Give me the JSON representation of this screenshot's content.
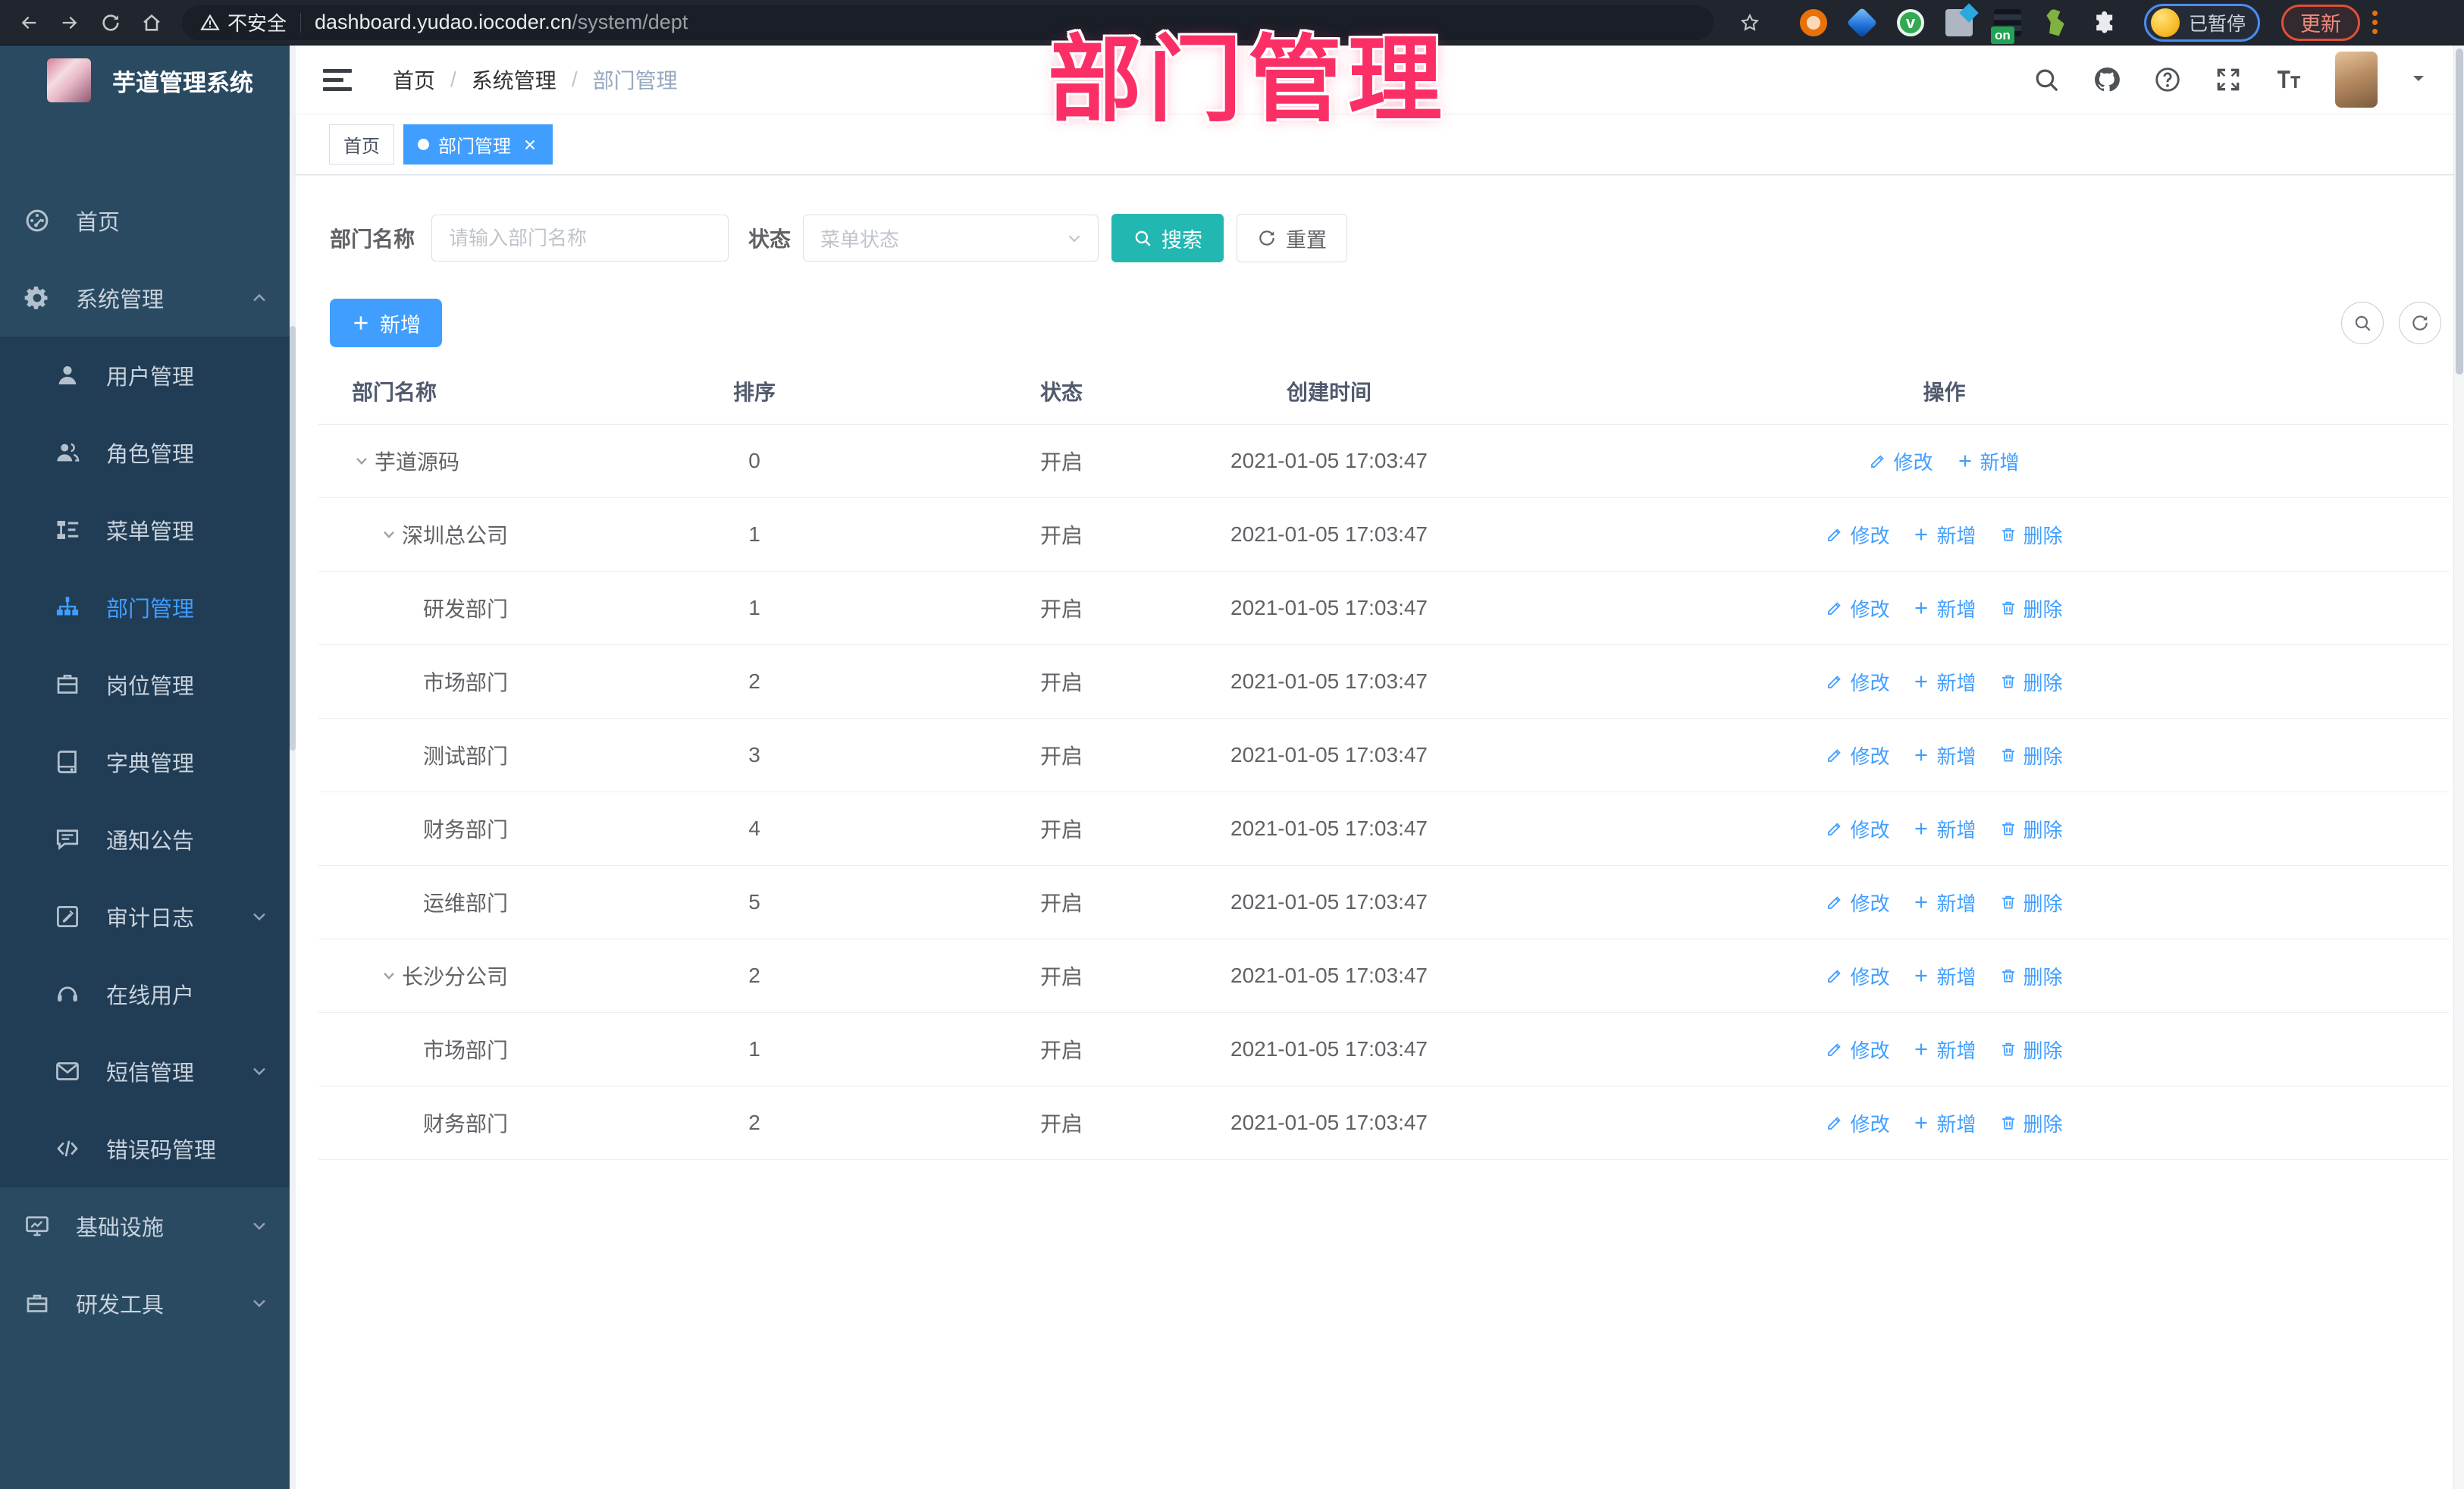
{
  "watermark": "部门管理",
  "colors": {
    "primary_blue": "#409eff",
    "search_teal": "#23b7b2",
    "watermark_pink": "#fb2f66",
    "sidebar_bg": "#2a4a62",
    "submenu_bg": "#213c55",
    "active_tab_bg": "#409eff"
  },
  "browser": {
    "security_label": "不安全",
    "url_host": "dashboard.yudao.iocoder.cn",
    "url_path": "/system/dept",
    "extension_badge": "on",
    "profile_status": "已暂停",
    "update_label": "更新"
  },
  "sidebar": {
    "title": "芋道管理系统",
    "items": [
      {
        "key": "home",
        "icon": "dashboard",
        "label": "首页",
        "sub": false
      },
      {
        "key": "system",
        "icon": "gear",
        "label": "系统管理",
        "sub": false,
        "chevron": "up"
      },
      {
        "key": "user",
        "icon": "user",
        "label": "用户管理",
        "sub": true
      },
      {
        "key": "role",
        "icon": "users",
        "label": "角色管理",
        "sub": true
      },
      {
        "key": "menu",
        "icon": "tree",
        "label": "菜单管理",
        "sub": true
      },
      {
        "key": "dept",
        "icon": "org",
        "label": "部门管理",
        "sub": true,
        "active": true
      },
      {
        "key": "post",
        "icon": "post",
        "label": "岗位管理",
        "sub": true
      },
      {
        "key": "dict",
        "icon": "book",
        "label": "字典管理",
        "sub": true
      },
      {
        "key": "notice",
        "icon": "notice",
        "label": "通知公告",
        "sub": true
      },
      {
        "key": "audit",
        "icon": "log",
        "label": "审计日志",
        "sub": true,
        "chevron": "down"
      },
      {
        "key": "online",
        "icon": "online",
        "label": "在线用户",
        "sub": true
      },
      {
        "key": "sms",
        "icon": "sms",
        "label": "短信管理",
        "sub": true,
        "chevron": "down"
      },
      {
        "key": "errcode",
        "icon": "code",
        "label": "错误码管理",
        "sub": true
      },
      {
        "key": "infra",
        "icon": "infra",
        "label": "基础设施",
        "sub": false,
        "chevron": "down"
      },
      {
        "key": "tools",
        "icon": "tools",
        "label": "研发工具",
        "sub": false,
        "chevron": "down"
      }
    ]
  },
  "header": {
    "breadcrumb": [
      "首页",
      "系统管理",
      "部门管理"
    ]
  },
  "tabs": [
    {
      "label": "首页",
      "active": false
    },
    {
      "label": "部门管理",
      "active": true,
      "closable": true
    }
  ],
  "filters": {
    "dept_label": "部门名称",
    "dept_placeholder": "请输入部门名称",
    "dept_value": "",
    "status_label": "状态",
    "status_placeholder": "菜单状态",
    "search_label": "搜索",
    "reset_label": "重置"
  },
  "toolbar": {
    "add_label": "新增"
  },
  "table": {
    "columns": [
      "部门名称",
      "排序",
      "状态",
      "创建时间",
      "操作"
    ],
    "op_labels": {
      "edit": "修改",
      "add": "新增",
      "del": "删除"
    },
    "rows": [
      {
        "name": "芋道源码",
        "level": 0,
        "expand": true,
        "sort": "0",
        "status": "开启",
        "time": "2021-01-05 17:03:47",
        "ops": [
          "edit",
          "add"
        ]
      },
      {
        "name": "深圳总公司",
        "level": 1,
        "expand": true,
        "sort": "1",
        "status": "开启",
        "time": "2021-01-05 17:03:47",
        "ops": [
          "edit",
          "add",
          "del"
        ]
      },
      {
        "name": "研发部门",
        "level": 2,
        "expand": false,
        "sort": "1",
        "status": "开启",
        "time": "2021-01-05 17:03:47",
        "ops": [
          "edit",
          "add",
          "del"
        ]
      },
      {
        "name": "市场部门",
        "level": 2,
        "expand": false,
        "sort": "2",
        "status": "开启",
        "time": "2021-01-05 17:03:47",
        "ops": [
          "edit",
          "add",
          "del"
        ]
      },
      {
        "name": "测试部门",
        "level": 2,
        "expand": false,
        "sort": "3",
        "status": "开启",
        "time": "2021-01-05 17:03:47",
        "ops": [
          "edit",
          "add",
          "del"
        ]
      },
      {
        "name": "财务部门",
        "level": 2,
        "expand": false,
        "sort": "4",
        "status": "开启",
        "time": "2021-01-05 17:03:47",
        "ops": [
          "edit",
          "add",
          "del"
        ]
      },
      {
        "name": "运维部门",
        "level": 2,
        "expand": false,
        "sort": "5",
        "status": "开启",
        "time": "2021-01-05 17:03:47",
        "ops": [
          "edit",
          "add",
          "del"
        ]
      },
      {
        "name": "长沙分公司",
        "level": 1,
        "expand": true,
        "sort": "2",
        "status": "开启",
        "time": "2021-01-05 17:03:47",
        "ops": [
          "edit",
          "add",
          "del"
        ]
      },
      {
        "name": "市场部门",
        "level": 2,
        "expand": false,
        "sort": "1",
        "status": "开启",
        "time": "2021-01-05 17:03:47",
        "ops": [
          "edit",
          "add",
          "del"
        ]
      },
      {
        "name": "财务部门",
        "level": 2,
        "expand": false,
        "sort": "2",
        "status": "开启",
        "time": "2021-01-05 17:03:47",
        "ops": [
          "edit",
          "add",
          "del"
        ]
      }
    ]
  }
}
